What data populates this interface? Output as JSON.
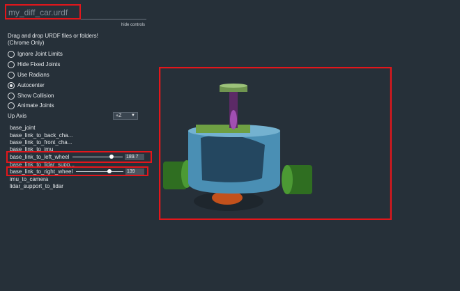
{
  "title_value": "my_diff_car.urdf",
  "hide_controls": "hide controls",
  "instructions": "Drag and drop URDF files or folders!\n(Chrome Only)",
  "toggles": [
    {
      "label": "Ignore Joint Limits",
      "checked": false
    },
    {
      "label": "Hide Fixed Joints",
      "checked": false
    },
    {
      "label": "Use Radians",
      "checked": false
    },
    {
      "label": "Autocenter",
      "checked": true
    },
    {
      "label": "Show Collision",
      "checked": false
    },
    {
      "label": "Animate Joints",
      "checked": false
    }
  ],
  "up_axis": {
    "label": "Up Axis",
    "value": "+Z"
  },
  "joints": [
    {
      "name": "base_joint"
    },
    {
      "name": "base_link_to_back_cha..."
    },
    {
      "name": "base_link_to_front_cha..."
    },
    {
      "name": "base_link_to_imu"
    },
    {
      "name": "base_link_to_left_wheel",
      "value": "189.7",
      "slider_fraction": 0.8
    },
    {
      "name": "base_link_to_lidar_supp..."
    },
    {
      "name": "base_link_to_right_wheel",
      "value": "139",
      "slider_fraction": 0.72
    },
    {
      "name": "imu_to_camera"
    },
    {
      "name": "lidar_support_to_lidar"
    }
  ],
  "colors": {
    "background": "#263039",
    "highlight": "#e3161b",
    "body": "#4a8fb4",
    "wheel": "#3f8a2c",
    "lidar": "#8db06c",
    "lidar_support": "#5c2a66",
    "caster": "#c2511c"
  }
}
